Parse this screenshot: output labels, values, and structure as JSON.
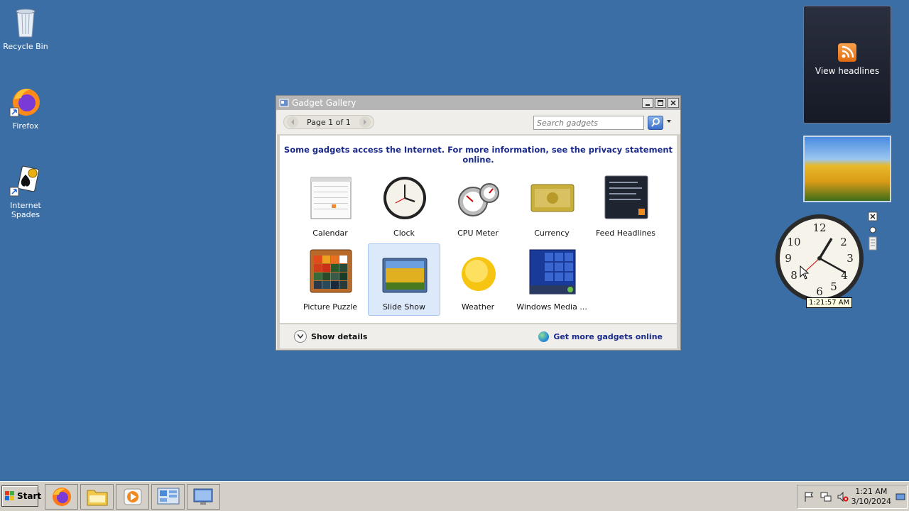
{
  "desktop": {
    "icons": [
      {
        "label": "Recycle Bin",
        "icon": "recycle-bin-icon"
      },
      {
        "label": "Firefox",
        "icon": "firefox-icon"
      },
      {
        "label": "Internet\nSpades",
        "icon": "internet-spades-icon"
      }
    ]
  },
  "window": {
    "title": "Gadget Gallery",
    "pager": {
      "text": "Page 1 of 1"
    },
    "search": {
      "placeholder": "Search gadgets"
    },
    "notice": "Some gadgets access the Internet.  For more information, see the privacy statement online.",
    "gadgets": [
      {
        "label": "Calendar",
        "icon": "calendar-icon",
        "selected": false
      },
      {
        "label": "Clock",
        "icon": "clock-icon",
        "selected": false
      },
      {
        "label": "CPU Meter",
        "icon": "cpu-meter-icon",
        "selected": false
      },
      {
        "label": "Currency",
        "icon": "currency-icon",
        "selected": false
      },
      {
        "label": "Feed Headlines",
        "icon": "feed-headlines-icon",
        "selected": false
      },
      {
        "label": "Picture Puzzle",
        "icon": "picture-puzzle-icon",
        "selected": false
      },
      {
        "label": "Slide Show",
        "icon": "slide-show-icon",
        "selected": true
      },
      {
        "label": "Weather",
        "icon": "weather-icon",
        "selected": false
      },
      {
        "label": "Windows Media ...",
        "icon": "windows-media-icon",
        "selected": false
      }
    ],
    "footer": {
      "show_details": "Show details",
      "get_more": "Get more gadgets online"
    }
  },
  "sidebar": {
    "feed": {
      "label": "View headlines"
    },
    "clock": {
      "tooltip": "1:21:57 AM"
    }
  },
  "taskbar": {
    "start_label": "Start",
    "apps": [
      {
        "icon": "firefox-icon"
      },
      {
        "icon": "file-explorer-icon"
      },
      {
        "icon": "media-player-icon"
      },
      {
        "icon": "gadgets-icon"
      },
      {
        "icon": "remote-desktop-icon"
      }
    ],
    "tray": {
      "time": "1:21 AM",
      "date": "3/10/2024",
      "icons": [
        "flag-icon",
        "network-icon",
        "volume-muted-icon"
      ]
    }
  },
  "colors": {
    "desktop": "#3a6ea5",
    "notice_text": "#1a2a8c",
    "selection": "#dce9fb"
  }
}
